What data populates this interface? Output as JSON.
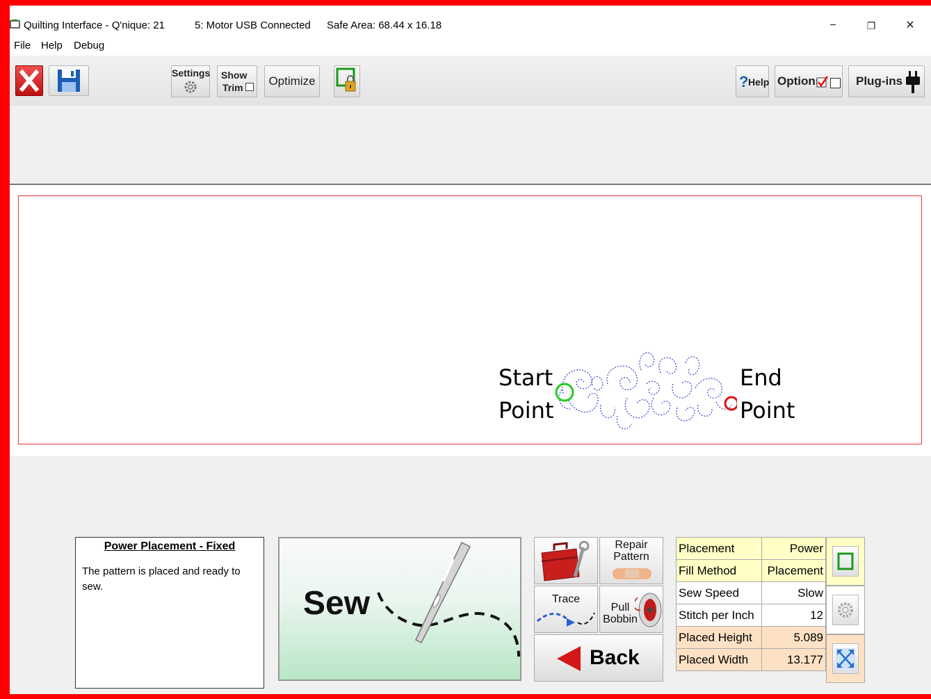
{
  "titlebar": {
    "app_title": "Quilting Interface  - Q'nique: 21",
    "motor_status": "5: Motor USB Connected",
    "safe_area": "Safe Area:  68.44 x 16.18",
    "minimize": "−",
    "restore": "❐",
    "close": "✕"
  },
  "menu": {
    "file": "File",
    "help": "Help",
    "debug": "Debug"
  },
  "toolbar": {
    "settings": "Settings",
    "show": "Show",
    "trim": "Trim",
    "optimize": "Optimize",
    "help_q": "?",
    "help": "Help",
    "options": "Options",
    "plugins": "Plug-ins",
    "show_trim_checked": false,
    "options_checked": true,
    "options_box2_checked": false
  },
  "canvas": {
    "start_1": "Start",
    "start_2": "Point",
    "end_1": "End",
    "end_2": "Point",
    "start_color": "#22cc22",
    "end_color": "#dd1111",
    "stitch_color": "#3a4fd8"
  },
  "info": {
    "title": "Power Placement - Fixed",
    "body": "The pattern is placed and ready to sew."
  },
  "buttons": {
    "sew": "Sew",
    "repair_1": "Repair",
    "repair_2": "Pattern",
    "trace": "Trace",
    "pull_1": "Pull",
    "pull_2": "Bobbin",
    "back": "Back"
  },
  "properties": [
    {
      "label": "Placement",
      "value": "Power"
    },
    {
      "label": "Fill Method",
      "value": "Placement"
    },
    {
      "label": "Sew Speed",
      "value": "Slow"
    },
    {
      "label": "Stitch per Inch",
      "value": "12"
    },
    {
      "label": "Placed Height",
      "value": "5.089"
    },
    {
      "label": "Placed Width",
      "value": "13.177"
    }
  ]
}
